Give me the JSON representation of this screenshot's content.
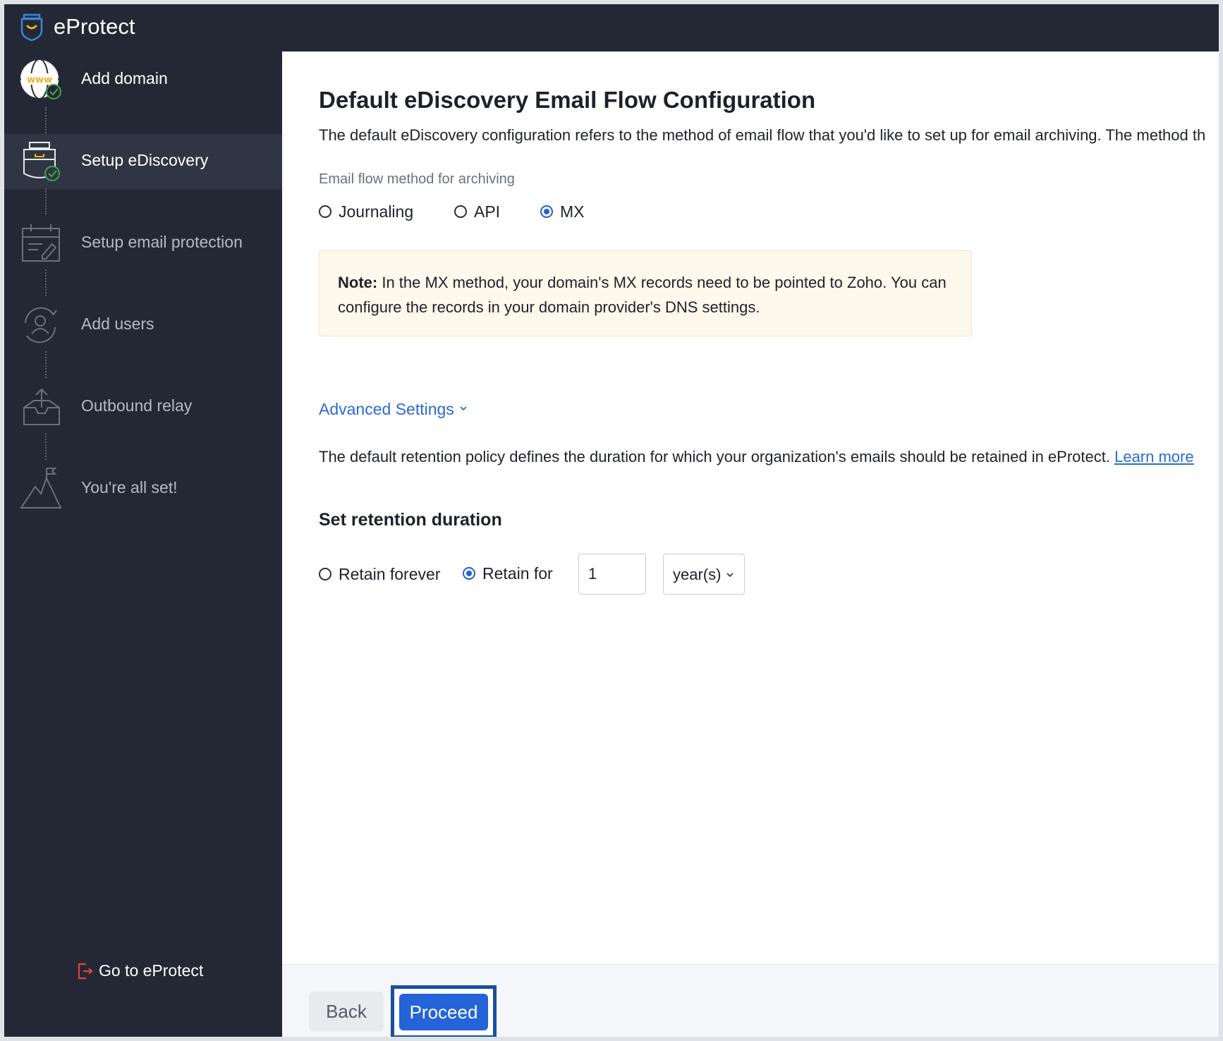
{
  "app": {
    "name": "eProtect"
  },
  "sidebar": {
    "steps": [
      {
        "label": "Add domain",
        "state": "done"
      },
      {
        "label": "Setup eDiscovery",
        "state": "active"
      },
      {
        "label": "Setup email protection",
        "state": "pending"
      },
      {
        "label": "Add users",
        "state": "pending"
      },
      {
        "label": "Outbound relay",
        "state": "pending"
      },
      {
        "label": "You're all set!",
        "state": "pending"
      }
    ],
    "goto_label": "Go to eProtect"
  },
  "main": {
    "title": "Default eDiscovery Email Flow Configuration",
    "description": "The default eDiscovery configuration refers to the method of email flow that you'd like to set up for email archiving. The method th",
    "flow_method": {
      "label": "Email flow method for archiving",
      "options": [
        "Journaling",
        "API",
        "MX"
      ],
      "selected": "MX"
    },
    "note": {
      "prefix": "Note:",
      "text": " In the MX method, your domain's MX records need to be pointed to Zoho. You can configure the records in your domain provider's DNS settings."
    },
    "advanced_settings": "Advanced Settings",
    "retention": {
      "description": "The default retention policy defines the duration for which your organization's emails should be retained in eProtect.",
      "learn_more": "Learn more",
      "title": "Set retention duration",
      "options": [
        "Retain forever",
        "Retain for"
      ],
      "selected": "Retain for",
      "value": "1",
      "unit": "year(s)"
    }
  },
  "footer": {
    "back_label": "Back",
    "proceed_label": "Proceed"
  },
  "colors": {
    "sidebar_bg": "#232834",
    "active_step_bg": "#2f3543",
    "accent_blue": "#2563d9",
    "link_blue": "#2a6bcf",
    "note_bg": "#fff8ec",
    "success_green": "#3fa34d",
    "brand_yellow": "#f2b01e",
    "goto_red": "#e5413b"
  },
  "icons": {
    "brand": "eprotect-logo-icon",
    "steps": [
      "globe-www-icon",
      "archive-box-icon",
      "calendar-edit-icon",
      "user-sync-icon",
      "outbox-tray-icon",
      "mountain-flag-icon"
    ],
    "goto": "exit-door-icon"
  }
}
